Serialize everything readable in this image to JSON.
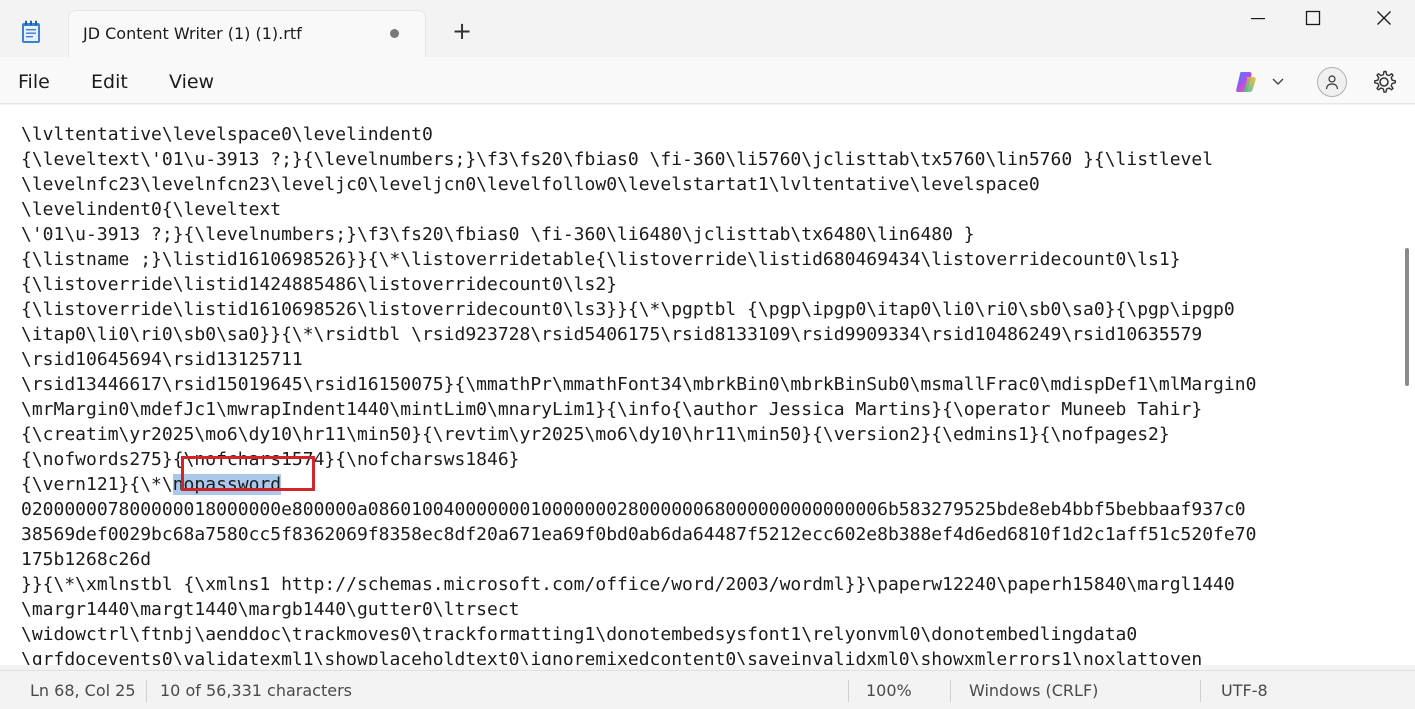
{
  "window": {
    "tab_title": "JD Content Writer (1) (1).rtf",
    "new_tab_symbol": "+"
  },
  "menu": {
    "file": "File",
    "edit": "Edit",
    "view": "View"
  },
  "editor": {
    "lines": [
      "                                                    ",
      "\\lvltentative\\levelspace0\\levelindent0",
      "{\\leveltext\\'01\\u-3913 ?;}{\\levelnumbers;}\\f3\\fs20\\fbias0 \\fi-360\\li5760\\jclisttab\\tx5760\\lin5760 }{\\listlevel",
      "\\levelnfc23\\levelnfcn23\\leveljc0\\leveljcn0\\levelfollow0\\levelstartat1\\lvltentative\\levelspace0",
      "\\levelindent0{\\leveltext",
      "\\'01\\u-3913 ?;}{\\levelnumbers;}\\f3\\fs20\\fbias0 \\fi-360\\li6480\\jclisttab\\tx6480\\lin6480 }",
      "{\\listname ;}\\listid1610698526}}{\\*\\listoverridetable{\\listoverride\\listid680469434\\listoverridecount0\\ls1}",
      "{\\listoverride\\listid1424885486\\listoverridecount0\\ls2}",
      "{\\listoverride\\listid1610698526\\listoverridecount0\\ls3}}{\\*\\pgptbl {\\pgp\\ipgp0\\itap0\\li0\\ri0\\sb0\\sa0}{\\pgp\\ipgp0",
      "\\itap0\\li0\\ri0\\sb0\\sa0}}{\\*\\rsidtbl \\rsid923728\\rsid5406175\\rsid8133109\\rsid9909334\\rsid10486249\\rsid10635579",
      "\\rsid10645694\\rsid13125711",
      "\\rsid13446617\\rsid15019645\\rsid16150075}{\\mmathPr\\mmathFont34\\mbrkBin0\\mbrkBinSub0\\msmallFrac0\\mdispDef1\\mlMargin0",
      "\\mrMargin0\\mdefJc1\\mwrapIndent1440\\mintLim0\\mnaryLim1}{\\info{\\author Jessica Martins}{\\operator Muneeb Tahir}",
      "{\\creatim\\yr2025\\mo6\\dy10\\hr11\\min50}{\\revtim\\yr2025\\mo6\\dy10\\hr11\\min50}{\\version2}{\\edmins1}{\\nofpages2}",
      "{\\nofwords275}{\\nofchars1574}{\\nofcharsws1846}",
      "__SELECTION_LINE__",
      "020000007800000018000000e800000a086010040000000100000002800000068000000000000006b583279525bde8eb4bbf5bebbaaf937c0",
      "38569def0029bc68a7580cc5f8362069f8358ec8df20a671ea69f0bd0ab6da64487f5212ecc602e8b388ef4d6ed6810f1d2c1aff51c520fe70",
      "175b1268c26d",
      "}}{\\*\\xmlnstbl {\\xmlns1 http://schemas.microsoft.com/office/word/2003/wordml}}\\paperw12240\\paperh15840\\margl1440",
      "\\margr1440\\margt1440\\margb1440\\gutter0\\ltrsect",
      "\\widowctrl\\ftnbj\\aenddoc\\trackmoves0\\trackformatting1\\donotembedsysfont1\\relyonvml0\\donotembedlingdata0",
      "\\grfdocevents0\\validatexml1\\showplaceholdtext0\\ignoremixedcontent0\\saveinvalidxml0\\showxmlerrors1\\noxlattoyen"
    ],
    "selection_prefix": "{\\vern121}{\\*\\",
    "selection_text": "nopassword"
  },
  "status": {
    "position": "Ln 68, Col 25",
    "characters": "10 of 56,331 characters",
    "zoom": "100%",
    "line_ending": "Windows (CRLF)",
    "encoding": "UTF-8"
  }
}
